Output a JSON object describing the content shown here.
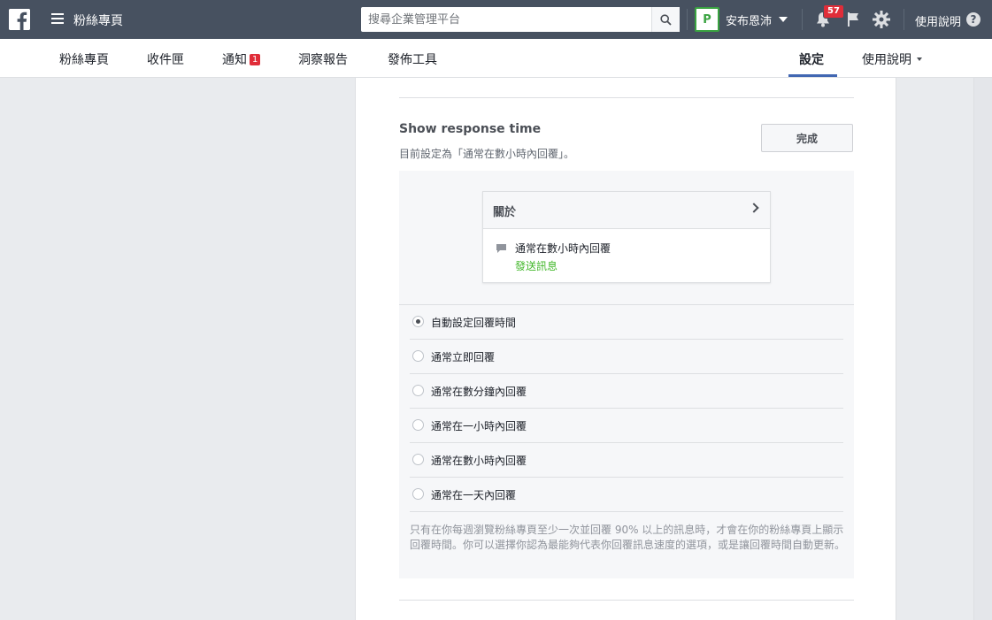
{
  "topbar": {
    "app_title": "粉絲專頁",
    "search_placeholder": "搜尋企業管理平台",
    "profile_name": "安布恩沛",
    "avatar_initials": "P",
    "notification_count": "57",
    "help_label": "使用說明",
    "help_symbol": "?"
  },
  "pagenav": {
    "items": [
      {
        "label": "粉絲專頁"
      },
      {
        "label": "收件匣"
      },
      {
        "label": "通知",
        "badge": "1"
      },
      {
        "label": "洞察報告"
      },
      {
        "label": "發佈工具"
      }
    ],
    "settings_label": "設定",
    "help_label": "使用說明"
  },
  "section": {
    "title": "Show response time",
    "subtitle": "目前設定為「通常在數小時內回覆」。",
    "done_label": "完成"
  },
  "preview": {
    "header_label": "關於",
    "response_text": "通常在數小時內回覆",
    "send_message_label": "發送訊息"
  },
  "options": [
    {
      "label": "自動設定回覆時間",
      "checked": true
    },
    {
      "label": "通常立即回覆",
      "checked": false
    },
    {
      "label": "通常在數分鐘內回覆",
      "checked": false
    },
    {
      "label": "通常在一小時內回覆",
      "checked": false
    },
    {
      "label": "通常在數小時內回覆",
      "checked": false
    },
    {
      "label": "通常在一天內回覆",
      "checked": false
    }
  ],
  "note": "只有在你每週瀏覽粉絲專頁至少一次並回覆 90% 以上的訊息時，才會在你的粉絲專頁上顯示回覆時間。你可以選擇你認為最能夠代表你回覆訊息速度的選項，或是讓回覆時間自動更新。",
  "colors": {
    "topbar": "#475160",
    "accent": "#4267b2",
    "badge": "#e02d39",
    "link_green": "#42b72a"
  }
}
